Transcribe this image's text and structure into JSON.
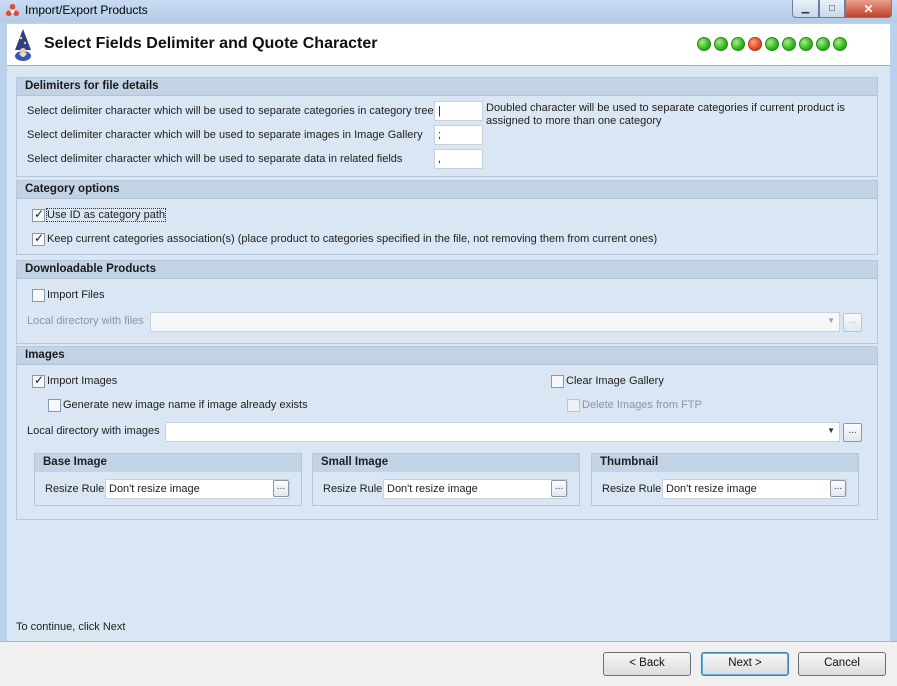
{
  "window": {
    "title": "Import/Export Products",
    "minimize_icon": "minimize-icon",
    "maximize_icon": "maximize-icon",
    "close_icon": "close-icon"
  },
  "header": {
    "title": "Select Fields Delimiter and Quote Character",
    "steps": {
      "total": 9,
      "current": 4
    }
  },
  "delimiters": {
    "heading": "Delimiters for file details",
    "categories_label": "Select delimiter character which will be used to separate categories in category tree",
    "categories_value": "|",
    "categories_note": "Doubled character will be used to separate categories if current product is assigned to more than one category",
    "images_label": "Select delimiter character which will be used to separate images in Image Gallery",
    "images_value": ";",
    "related_label": "Select delimiter character which will be used to separate data in related fields",
    "related_value": ","
  },
  "category_options": {
    "heading": "Category options",
    "use_id_label": "Use ID as category path",
    "use_id_checked": true,
    "keep_assoc_label": "Keep current categories association(s) (place product to categories specified in the file, not removing them from current ones)",
    "keep_assoc_checked": true
  },
  "downloadable": {
    "heading": "Downloadable Products",
    "import_files_label": "Import Files",
    "import_files_checked": false,
    "local_dir_label": "Local directory with files",
    "local_dir_value": "",
    "browse_label": "..."
  },
  "images": {
    "heading": "Images",
    "import_images_label": "Import Images",
    "import_images_checked": true,
    "clear_gallery_label": "Clear Image Gallery",
    "clear_gallery_checked": false,
    "generate_name_label": "Generate new image name if image already exists",
    "generate_name_checked": false,
    "delete_ftp_label": "Delete Images from FTP",
    "delete_ftp_checked": false,
    "local_dir_label": "Local directory with images",
    "local_dir_value": "",
    "browse_label": "...",
    "base": {
      "heading": "Base Image",
      "resize_label": "Resize Rule",
      "resize_value": "Don't resize image",
      "browse_label": "..."
    },
    "small": {
      "heading": "Small Image",
      "resize_label": "Resize Rule",
      "resize_value": "Don't resize image",
      "browse_label": "..."
    },
    "thumb": {
      "heading": "Thumbnail",
      "resize_label": "Resize Rule",
      "resize_value": "Don't resize image",
      "browse_label": "..."
    }
  },
  "footer": {
    "hint": "To continue, click Next",
    "back_label": "< Back",
    "next_label": "Next >",
    "cancel_label": "Cancel"
  },
  "colors": {
    "step_done": "#33b51f",
    "step_current": "#e54a22"
  }
}
